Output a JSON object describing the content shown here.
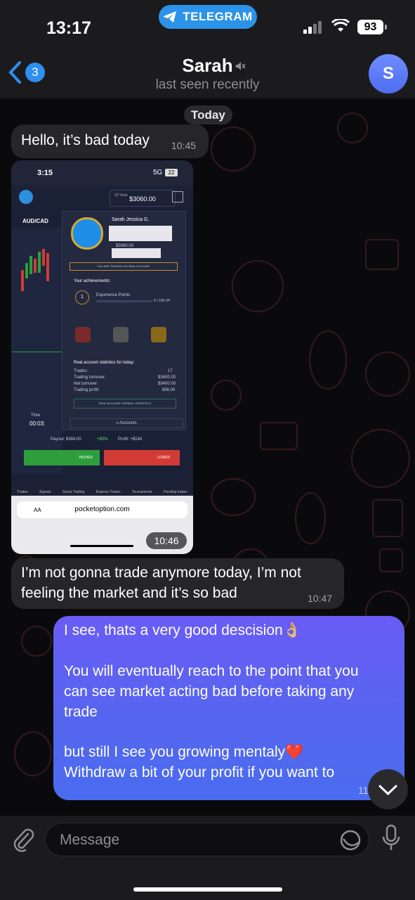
{
  "status_bar": {
    "time": "13:17",
    "app_pill": "TELEGRAM",
    "battery": "93"
  },
  "header": {
    "back_count": "3",
    "contact_name": "Sarah",
    "last_seen": "last seen recently",
    "avatar_initial": "S"
  },
  "chat": {
    "date_label": "Today",
    "messages": [
      {
        "text": "Hello, it’s bad today",
        "time": "10:45"
      },
      {
        "time": "10:46"
      },
      {
        "line1": "I’m not gonna trade anymore today, I’m not",
        "line2": "feeling the market and it’s so bad",
        "time": "10:47"
      },
      {
        "line1": "I see, thats a very good descision👌🏼",
        "line2": "You will eventually reach to the point that you",
        "line3": "can see market acting bad before taking any",
        "line4": "trade",
        "line5": "but still I see you growing mentaly❤️",
        "line6": "Withdraw a bit of your profit if you want to",
        "time": "11"
      }
    ]
  },
  "screenshot": {
    "clock": "3:15",
    "network": "5G",
    "battery": "22",
    "account_type": "QT Real",
    "balance": "$3060.00",
    "pair": "AUD/CAD",
    "user_name": "Sarah Jessica G.",
    "user_balance": "$3060.00",
    "real_account_notice": "YOU ARE TRADING ON REAL ACCOUNT",
    "achievements_title": "Your achievements:",
    "experience_label": "Experience Points",
    "experience_value": "0 / 100 XP",
    "level": "1",
    "stats_title": "Real account statistics for today:",
    "stats": [
      {
        "label": "Trades:",
        "value": "17"
      },
      {
        "label": "Trading turnover:",
        "value": "$3400.00"
      },
      {
        "label": "Net turnover:",
        "value": "$3400.00"
      },
      {
        "label": "Trading profit:",
        "value": "$56.00"
      }
    ],
    "overall_stats_button": "REAL ACCOUNT OVERALL STATISTICS",
    "accounts_button": "« Accounts",
    "time_label": "Time",
    "time_value": "00:03:",
    "payout": "Payout: $384.00",
    "payout_percent": "+92%",
    "profit": "Profit: +$184",
    "higher": "HIGHER",
    "lower": "LOWER",
    "nav_items": [
      "Trades",
      "Signals",
      "Social Trading",
      "Express Trades",
      "Tournaments",
      "Pending trades"
    ],
    "browser_url": "pocketoption.com",
    "browser_aa": "AA"
  },
  "composer": {
    "placeholder": "Message"
  },
  "colors": {
    "accent": "#2f8ef0",
    "outgoing_bubble": "#5a63f0",
    "incoming_bubble": "#262628",
    "higher_green": "#2e9e3c",
    "lower_red": "#d23b35"
  }
}
